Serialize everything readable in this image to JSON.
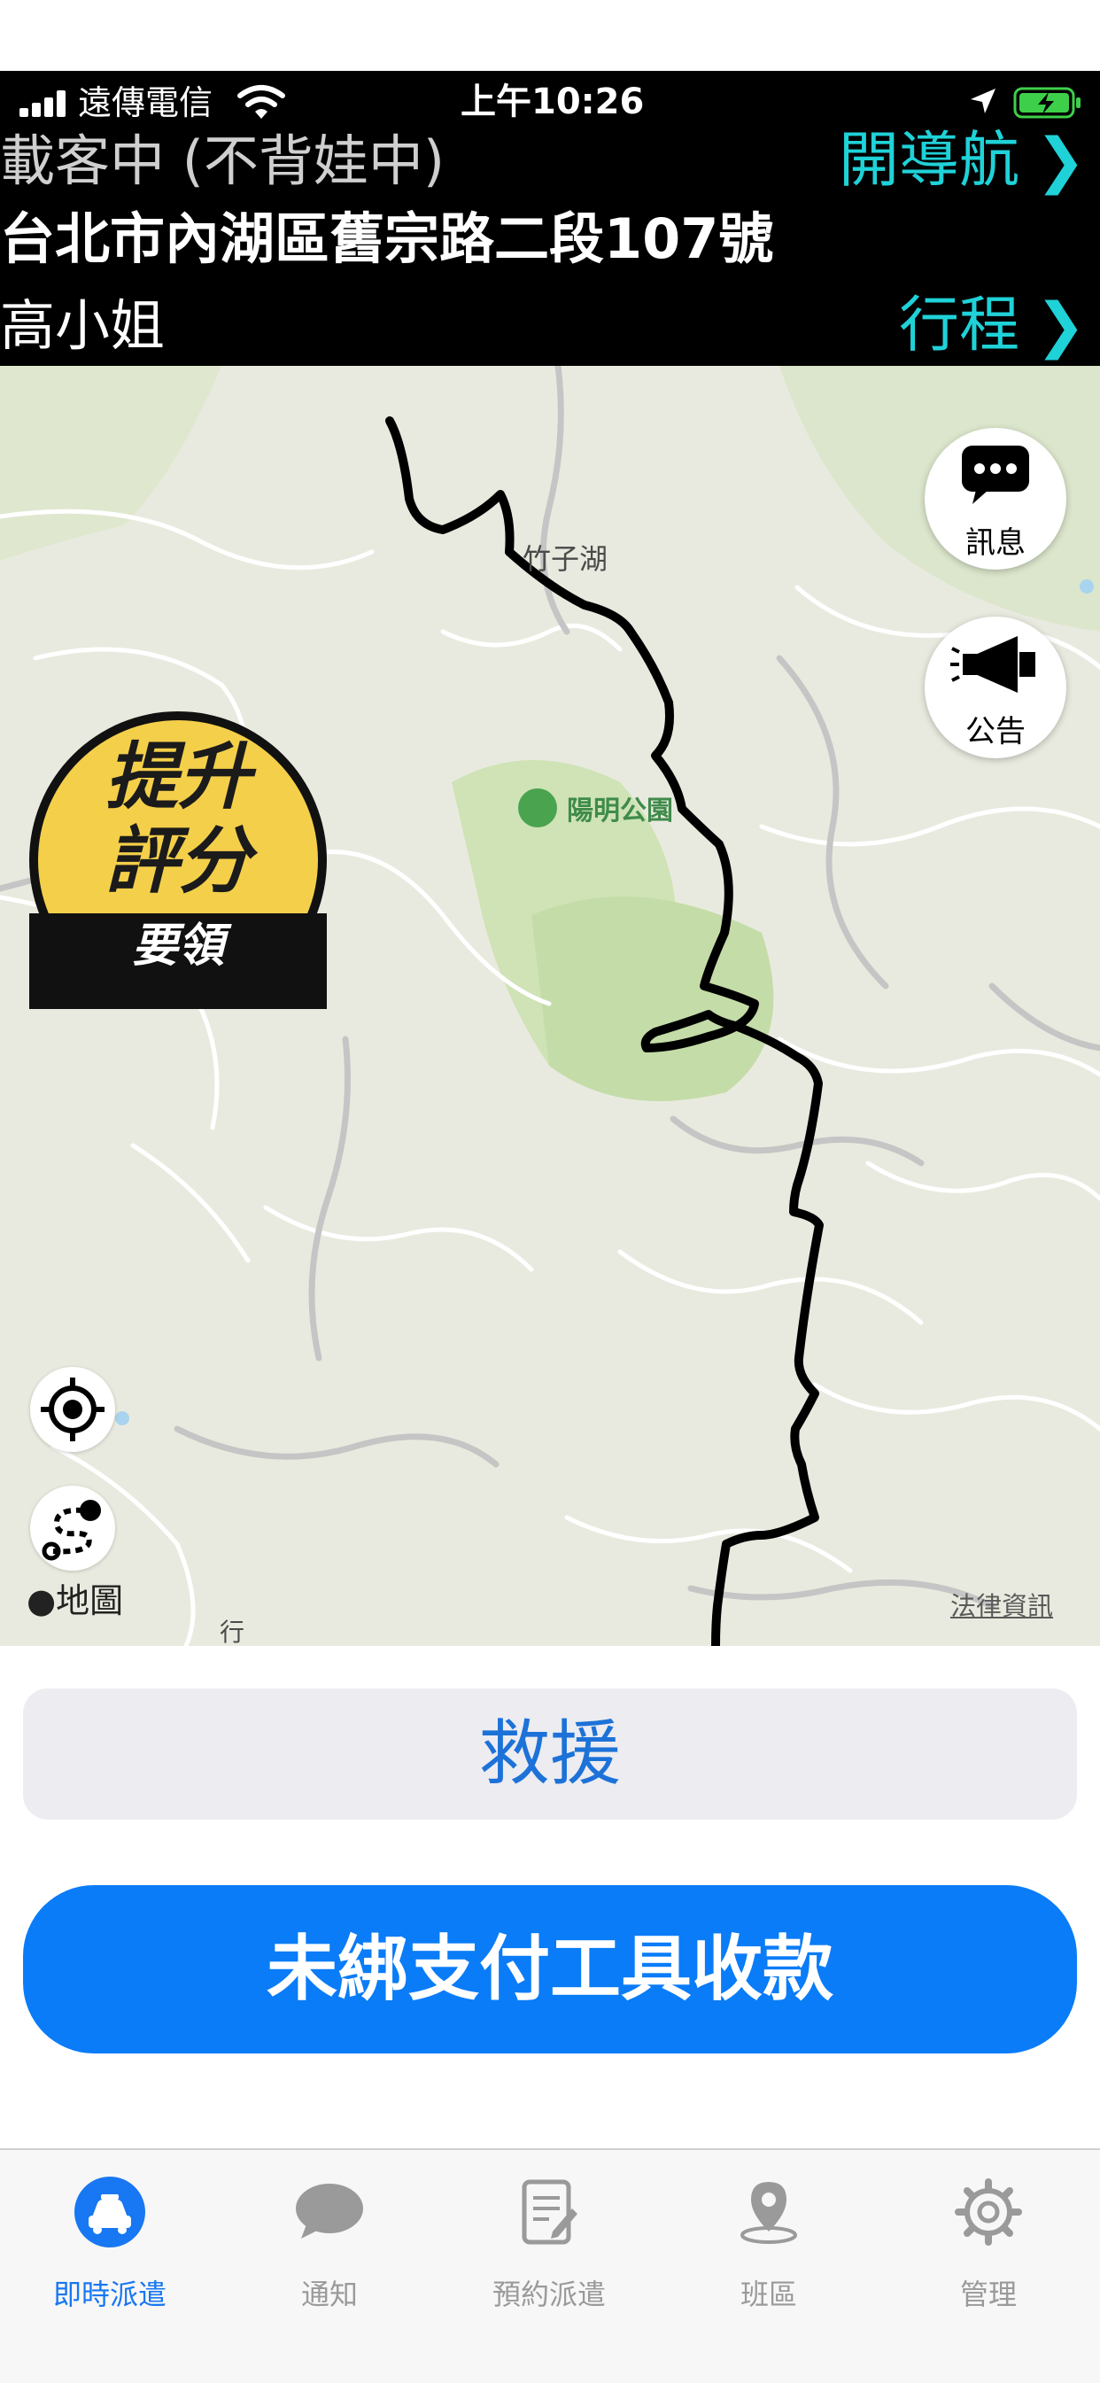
{
  "status_bar": {
    "carrier": "遠傳電信",
    "time": "上午10:26"
  },
  "trip_header": {
    "status": "載客中 (不背娃中)",
    "navigate_label": "開導航",
    "address": "台北市內湖區舊宗路二段107號",
    "passenger": "高小姐",
    "trip_label": "行程",
    "accent_color": "#1fd2d8"
  },
  "map": {
    "labels": {
      "lake": "竹子湖",
      "park": "陽明公園",
      "road_fragment": "行"
    },
    "message_button_label": "訊息",
    "announcement_button_label": "公告",
    "badge": {
      "line1": "提升",
      "line2": "評分",
      "line3": "要領"
    },
    "maps_logo": "地圖",
    "legal_link": "法律資訊"
  },
  "actions": {
    "rescue_label": "救援",
    "collect_label": "未綁支付工具收款"
  },
  "tab_bar": {
    "items": [
      {
        "label": "即時派遣",
        "icon": "taxi-icon",
        "active": true
      },
      {
        "label": "通知",
        "icon": "chat-bubble-icon",
        "active": false
      },
      {
        "label": "預約派遣",
        "icon": "document-edit-icon",
        "active": false
      },
      {
        "label": "班區",
        "icon": "map-pin-icon",
        "active": false
      },
      {
        "label": "管理",
        "icon": "gear-icon",
        "active": false
      }
    ],
    "active_color": "#1877f2"
  }
}
